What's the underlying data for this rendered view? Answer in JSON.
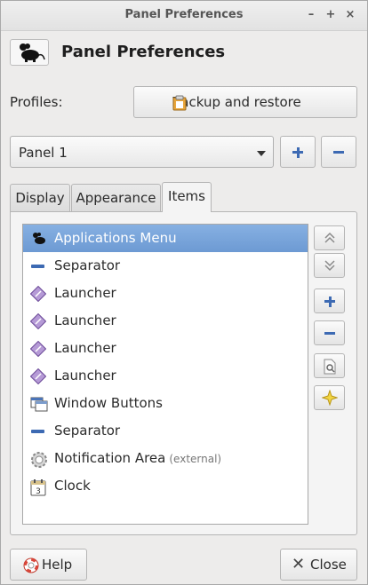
{
  "window": {
    "title": "Panel Preferences"
  },
  "header": {
    "title": "Panel Preferences"
  },
  "profiles": {
    "label": "Profiles:",
    "backup_button": "Backup and restore"
  },
  "panel_select": {
    "value": "Panel 1"
  },
  "tabs": [
    {
      "label": "Display"
    },
    {
      "label": "Appearance"
    },
    {
      "label": "Items"
    }
  ],
  "items": [
    {
      "label": "Applications Menu",
      "icon": "mouse-icon"
    },
    {
      "label": "Separator",
      "icon": "separator-icon"
    },
    {
      "label": "Launcher",
      "icon": "launcher-icon"
    },
    {
      "label": "Launcher",
      "icon": "launcher-icon"
    },
    {
      "label": "Launcher",
      "icon": "launcher-icon"
    },
    {
      "label": "Launcher",
      "icon": "launcher-icon"
    },
    {
      "label": "Window Buttons",
      "icon": "window-icon"
    },
    {
      "label": "Separator",
      "icon": "separator-icon"
    },
    {
      "label": "Notification Area",
      "extra": "(external)",
      "icon": "gear-icon"
    },
    {
      "label": "Clock",
      "icon": "calendar-icon"
    }
  ],
  "footer": {
    "help": "Help",
    "close": "Close"
  },
  "colors": {
    "selection": "#7aa4d9",
    "accent_blue": "#3d6ab3"
  }
}
